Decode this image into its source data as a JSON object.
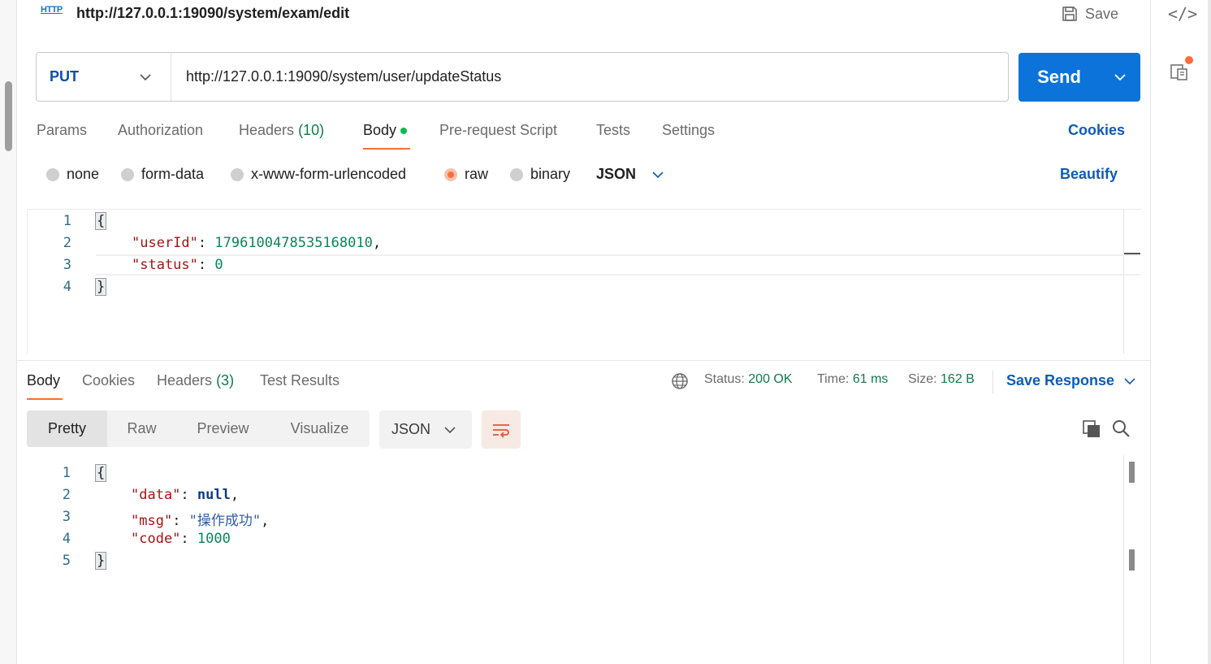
{
  "request": {
    "icon_label": "HTTP",
    "title": "http://127.0.0.1:19090/system/exam/edit",
    "save_label": "Save",
    "method": "PUT",
    "url": "http://127.0.0.1:19090/system/user/updateStatus",
    "send_label": "Send",
    "tabs": [
      {
        "label": "Params"
      },
      {
        "label": "Authorization"
      },
      {
        "label": "Headers",
        "count": "(10)"
      },
      {
        "label": "Body"
      },
      {
        "label": "Pre-request Script"
      },
      {
        "label": "Tests"
      },
      {
        "label": "Settings"
      }
    ],
    "cookies_label": "Cookies",
    "body_types": [
      "none",
      "form-data",
      "x-www-form-urlencoded",
      "raw",
      "binary"
    ],
    "selected_body_type": "raw",
    "raw_format": "JSON",
    "beautify_label": "Beautify",
    "body_lines": {
      "l1": "{",
      "l2_key": "\"userId\"",
      "l2_val": "1796100478535168010",
      "l3_key": "\"status\"",
      "l3_val": "0",
      "l4": "}"
    },
    "line_numbers": [
      "1",
      "2",
      "3",
      "4"
    ]
  },
  "response": {
    "tabs": [
      {
        "label": "Body"
      },
      {
        "label": "Cookies"
      },
      {
        "label": "Headers",
        "count": "(3)"
      },
      {
        "label": "Test Results"
      }
    ],
    "status_label": "Status:",
    "status_value": "200 OK",
    "time_label": "Time:",
    "time_value": "61 ms",
    "size_label": "Size:",
    "size_value": "162 B",
    "save_response_label": "Save Response",
    "view_modes": [
      "Pretty",
      "Raw",
      "Preview",
      "Visualize"
    ],
    "format": "JSON",
    "body_lines": {
      "l1": "{",
      "data_key": "\"data\"",
      "data_val": "null",
      "msg_key": "\"msg\"",
      "msg_val": "\"操作成功\"",
      "code_key": "\"code\"",
      "code_val": "1000",
      "l5": "}"
    },
    "line_numbers": [
      "1",
      "2",
      "3",
      "4",
      "5"
    ]
  },
  "colors": {
    "accent": "#ff6c37",
    "send": "#0b73d9",
    "link": "#0d5cb6",
    "status_ok": "#0f7b4a"
  }
}
